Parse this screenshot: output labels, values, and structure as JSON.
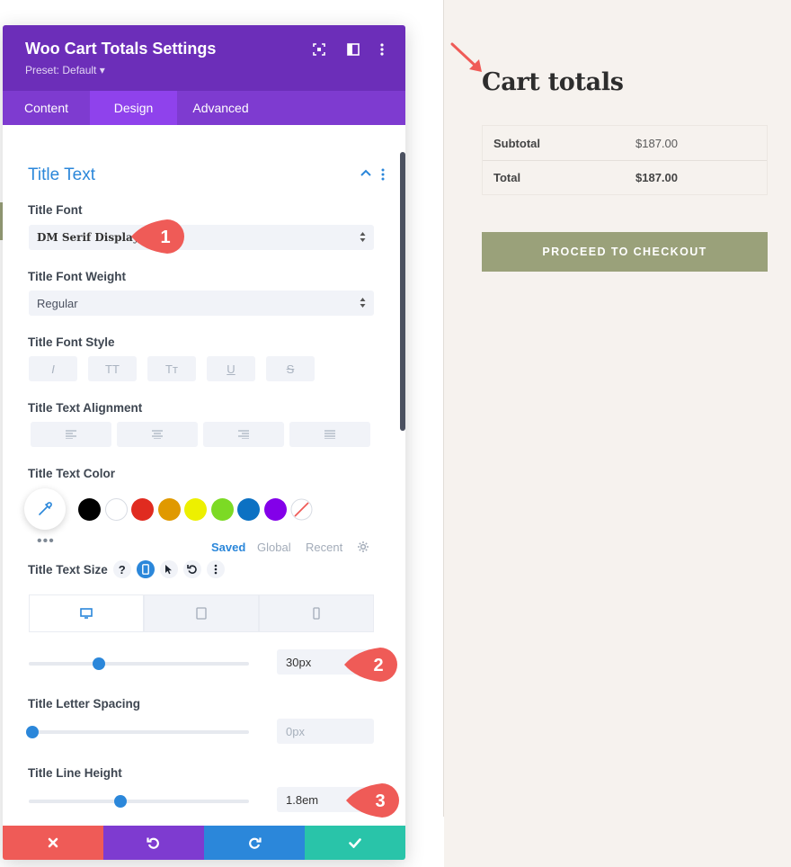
{
  "panel": {
    "title": "Woo Cart Totals Settings",
    "preset": "Preset: Default ▾",
    "header_icons": [
      "expand-icon",
      "split-view-icon",
      "more-options-icon"
    ],
    "tabs": [
      {
        "label": "Content",
        "active": false
      },
      {
        "label": "Design",
        "active": true
      },
      {
        "label": "Advanced",
        "active": false
      }
    ],
    "section": {
      "title": "Title Text",
      "title_font": {
        "label": "Title Font",
        "value": "DM Serif Display"
      },
      "title_font_weight": {
        "label": "Title Font Weight",
        "value": "Regular"
      },
      "title_font_style": {
        "label": "Title Font Style",
        "buttons": [
          "I",
          "TT",
          "Tт",
          "U",
          "S"
        ]
      },
      "title_text_alignment": {
        "label": "Title Text Alignment",
        "options": [
          "left",
          "center",
          "right",
          "justify"
        ]
      },
      "title_text_color": {
        "label": "Title Text Color",
        "swatches": [
          "#000000",
          "#ffffff",
          "#e02b20",
          "#e09900",
          "#edf000",
          "#7cda24",
          "#0c71c3",
          "#8300e9"
        ],
        "links": {
          "saved": "Saved",
          "global": "Global",
          "recent": "Recent"
        }
      },
      "title_text_size": {
        "label": "Title Text Size",
        "value": "30px",
        "slider": 0.3
      },
      "title_letter_spacing": {
        "label": "Title Letter Spacing",
        "value": "0px",
        "slider": 0.0
      },
      "title_line_height": {
        "label": "Title Line Height",
        "value": "1.8em",
        "slider": 0.4
      }
    },
    "callouts": [
      "1",
      "2",
      "3"
    ],
    "footer": [
      "cancel",
      "undo",
      "redo",
      "save"
    ]
  },
  "cart": {
    "title": "Cart totals",
    "rows": [
      {
        "label": "Subtotal",
        "value": "$187.00"
      },
      {
        "label": "Total",
        "value": "$187.00"
      }
    ],
    "checkout_label": "PROCEED TO CHECKOUT"
  },
  "colors": {
    "header": "#6c2eb9",
    "tabs": "#7e3bd0",
    "tab_active": "#8f42ec",
    "accent_blue": "#2b87da",
    "callout": "#ef5b57",
    "checkout": "#9aa17a",
    "footer": [
      "#ef5b57",
      "#7e3bd0",
      "#2b87da",
      "#29c4a9"
    ]
  }
}
